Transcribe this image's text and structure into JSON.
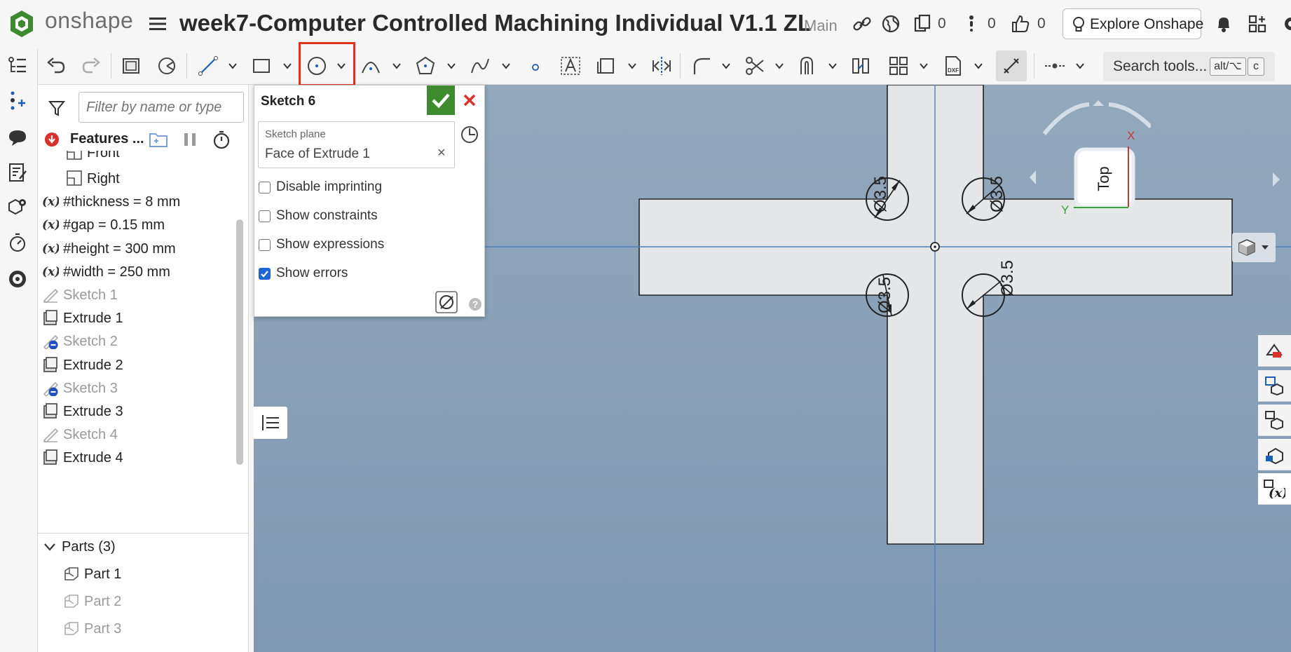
{
  "header": {
    "logo_text": "onshape",
    "document_title": "week7-Computer Controlled Machining Individual V1.1 ZL",
    "branch": "Main",
    "versions_count": "0",
    "comments_count": "0",
    "likes_count": "0",
    "explore_label": "Explore Onshape"
  },
  "toolbar": {
    "search_label": "Search tools...",
    "shortcut_key1": "alt/⌥",
    "shortcut_key2": "c"
  },
  "feature_panel": {
    "filter_placeholder": "Filter by name or type",
    "features_title": "Features ...",
    "partial_row": "Front",
    "rows": [
      {
        "label": "Right",
        "icon": "plane-icon",
        "dim": false
      },
      {
        "label": "#thickness = 8 mm",
        "icon": "variable-icon",
        "dim": false
      },
      {
        "label": "#gap = 0.15 mm",
        "icon": "variable-icon",
        "dim": false
      },
      {
        "label": "#height = 300 mm",
        "icon": "variable-icon",
        "dim": false
      },
      {
        "label": "#width = 250 mm",
        "icon": "variable-icon",
        "dim": false
      },
      {
        "label": "Sketch 1",
        "icon": "sketch-icon",
        "dim": true
      },
      {
        "label": "Extrude 1",
        "icon": "extrude-icon",
        "dim": false
      },
      {
        "label": "Sketch 2",
        "icon": "sketch-error-icon",
        "dim": true
      },
      {
        "label": "Extrude 2",
        "icon": "extrude-icon",
        "dim": false
      },
      {
        "label": "Sketch 3",
        "icon": "sketch-error-icon",
        "dim": true
      },
      {
        "label": "Extrude 3",
        "icon": "extrude-icon",
        "dim": false
      },
      {
        "label": "Sketch 4",
        "icon": "sketch-icon",
        "dim": true
      },
      {
        "label": "Extrude 4",
        "icon": "extrude-icon",
        "dim": false
      }
    ],
    "parts_header": "Parts (3)",
    "parts": [
      {
        "label": "Part 1",
        "dim": false
      },
      {
        "label": "Part 2",
        "dim": true
      },
      {
        "label": "Part 3",
        "dim": true
      }
    ]
  },
  "sketch_dialog": {
    "title": "Sketch 6",
    "plane_caption": "Sketch plane",
    "plane_value": "Face of Extrude 1",
    "clear": "×",
    "options": [
      {
        "label": "Disable imprinting",
        "checked": false
      },
      {
        "label": "Show constraints",
        "checked": false
      },
      {
        "label": "Show expressions",
        "checked": false
      },
      {
        "label": "Show errors",
        "checked": true
      }
    ]
  },
  "viewport": {
    "dim_top_left": "Ø3.5",
    "dim_top_right": "Ø3.5",
    "dim_bottom_left": "Ø3.5",
    "dim_bottom_right": "Ø3.5",
    "view_cube_label": "Top",
    "axis_x": "X",
    "axis_y": "Y"
  },
  "colors": {
    "accent_red": "#e0341e",
    "ok_green": "#3d8b2e",
    "checkbox_blue": "#1f66d1",
    "viewport_blue": "#8aa3ba"
  }
}
